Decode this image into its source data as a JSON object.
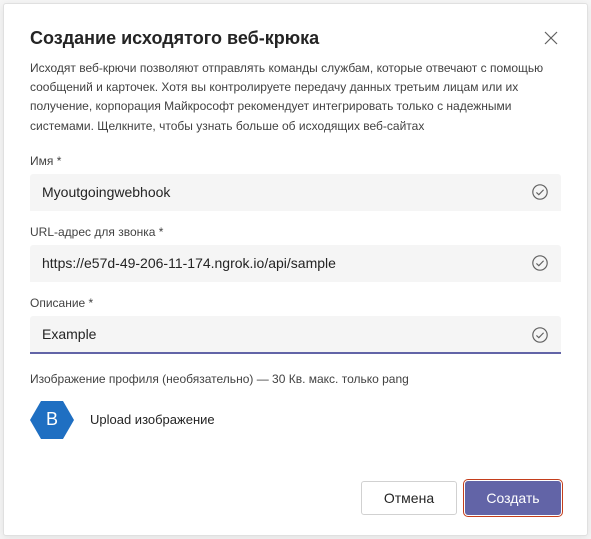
{
  "dialog": {
    "title": "Создание исходятого веб-крюка",
    "description": "Исходят веб-крючи позволяют отправлять команды службам, которые отвечают с помощью сообщений и карточек.      Хотя вы контролируете передачу данных третьим лицам или их получение, корпорация Майкрософт рекомендует интегрировать только с надежными системами. Щелкните, чтобы узнать больше об исходящих веб-сайтах"
  },
  "fields": {
    "name": {
      "label": "Имя *",
      "value": "Myoutgoingwebhook"
    },
    "url": {
      "label": "URL-адрес для звонка *",
      "value": "https://e57d-49-206-11-174.ngrok.io/api/sample"
    },
    "description": {
      "label": "Описание     *",
      "value": "Example"
    }
  },
  "profile": {
    "label": "Изображение профиля (необязательно) — 30 Кв. макс. только раng",
    "avatarLetter": "B",
    "uploadText": "Upload изображение"
  },
  "buttons": {
    "cancel": "Отмена",
    "create": "Создать"
  }
}
